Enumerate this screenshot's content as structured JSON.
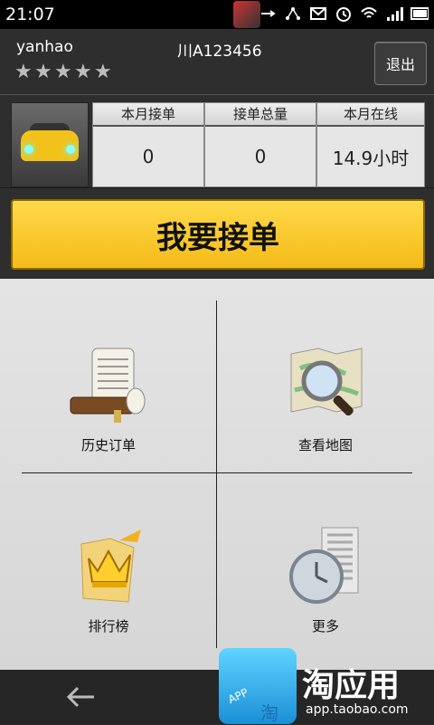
{
  "statusbar": {
    "time": "21:07"
  },
  "header": {
    "username": "yanhao",
    "plate": "川A123456",
    "rating_stars": 5,
    "logout_label": "退出"
  },
  "stats": [
    {
      "label": "本月接单",
      "value": "0"
    },
    {
      "label": "接单总量",
      "value": "0"
    },
    {
      "label": "本月在线",
      "value": "14.9小时"
    }
  ],
  "main_action": {
    "label": "我要接单"
  },
  "menu": [
    {
      "label": "历史订单",
      "icon": "history-scroll-icon"
    },
    {
      "label": "查看地图",
      "icon": "map-magnifier-icon"
    },
    {
      "label": "排行榜",
      "icon": "crown-ranking-icon"
    },
    {
      "label": "更多",
      "icon": "more-clock-icon"
    }
  ],
  "promo": {
    "brand": "淘应用",
    "site": "app.taobao.com",
    "bag_text": "APP",
    "bag_char": "淘"
  },
  "colors": {
    "accent": "#f4bb18",
    "dark": "#2e2e2e",
    "grid_bg": "#dcdcdc"
  }
}
